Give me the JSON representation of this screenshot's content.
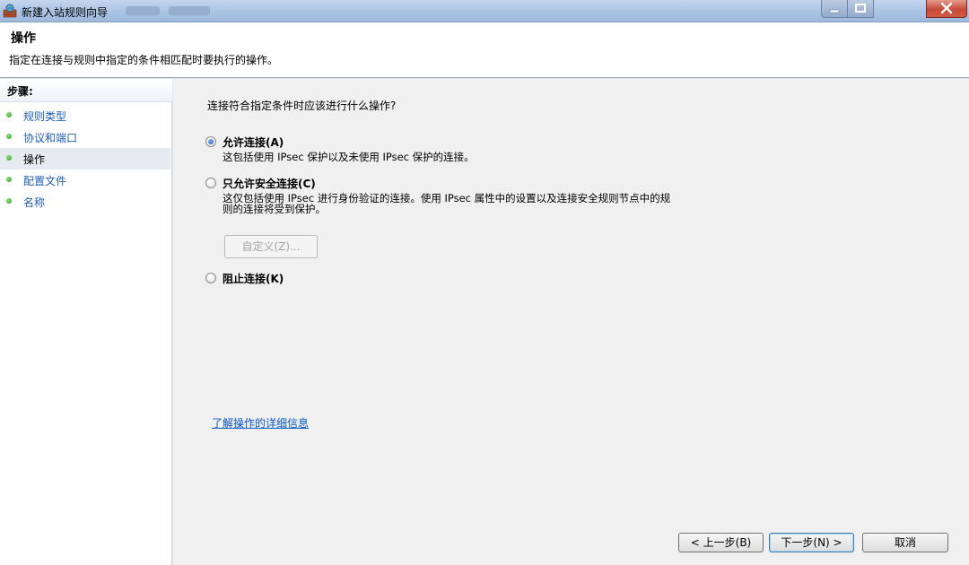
{
  "window": {
    "title": "新建入站规则向导",
    "icon": "firewall-icon"
  },
  "header": {
    "title": "操作",
    "description": "指定在连接与规则中指定的条件相匹配时要执行的操作。"
  },
  "sidebar": {
    "heading": "步骤:",
    "items": [
      {
        "label": "规则类型"
      },
      {
        "label": "协议和端口"
      },
      {
        "label": "操作"
      },
      {
        "label": "配置文件"
      },
      {
        "label": "名称"
      }
    ],
    "active_index": 2
  },
  "main": {
    "question": "连接符合指定条件时应该进行什么操作?",
    "options": [
      {
        "label": "允许连接(A)",
        "description": "这包括使用 IPsec 保护以及未使用 IPsec 保护的连接。",
        "selected": true
      },
      {
        "label": "只允许安全连接(C)",
        "description": "这仅包括使用 IPsec 进行身份验证的连接。使用 IPsec 属性中的设置以及连接安全规则节点中的规则的连接将受到保护。",
        "selected": false
      },
      {
        "label": "阻止连接(K)",
        "description": "",
        "selected": false
      }
    ],
    "customize_button": "自定义(Z)...",
    "learn_link": "了解操作的详细信息"
  },
  "footer": {
    "back_button": "< 上一步(B)",
    "next_button": "下一步(N) >",
    "cancel_button": "取消"
  },
  "colors": {
    "link": "#0a58c4",
    "step_link": "#1f5fb4",
    "panel_bg": "#f0f0f0"
  }
}
